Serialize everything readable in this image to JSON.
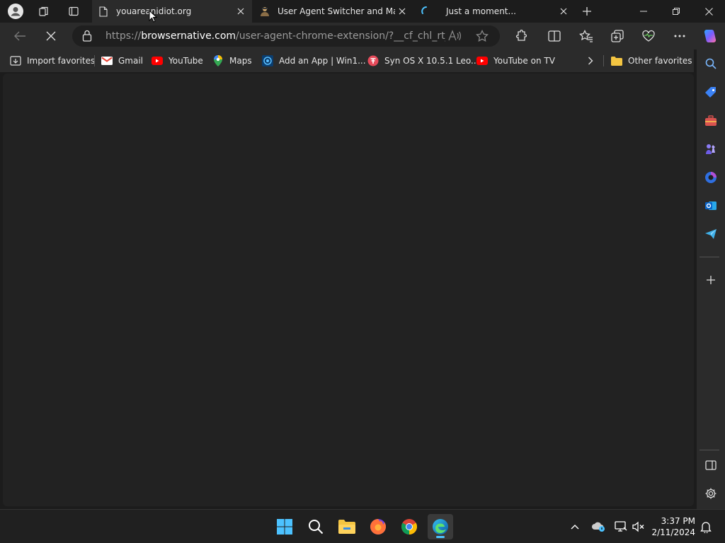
{
  "tabs": [
    {
      "title": "youareanidiot.org",
      "favicon": "page-icon",
      "active": true
    },
    {
      "title": "User Agent Switcher and Mana",
      "favicon": "agent-icon",
      "active": false
    },
    {
      "title": "Just a moment...",
      "favicon": "loading-icon",
      "active": false
    }
  ],
  "address_bar": {
    "url_prefix": "https://",
    "url_host": "browsernative.com",
    "url_rest": "/user-agent-chrome-extension/?__cf_chl_rt_tk=A..."
  },
  "bookmarks": [
    {
      "label": "Import favorites",
      "icon": "import-icon"
    },
    {
      "label": "Gmail",
      "icon": "gmail-icon"
    },
    {
      "label": "YouTube",
      "icon": "youtube-icon"
    },
    {
      "label": "Maps",
      "icon": "maps-icon"
    },
    {
      "label": "Add an App | Win1...",
      "icon": "app-icon"
    },
    {
      "label": "Syn OS X 10.5.1 Leo...",
      "icon": "syn-icon"
    },
    {
      "label": "YouTube on TV",
      "icon": "youtube-icon"
    }
  ],
  "other_favorites": "Other favorites",
  "clock": {
    "time": "3:37 PM",
    "date": "2/11/2024"
  },
  "colors": {
    "accent": "#4cc2ff",
    "youtube": "#ff0000",
    "folder": "#f4c542"
  }
}
